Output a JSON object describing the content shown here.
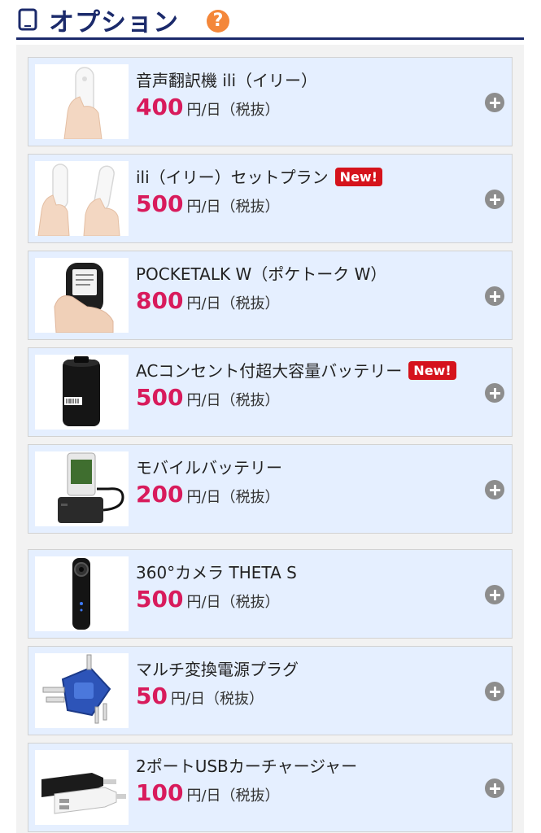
{
  "header": {
    "title": "オプション",
    "help_icon": "?"
  },
  "options": [
    {
      "name": "音声翻訳機 ili（イリー）",
      "badge": "",
      "price": "400",
      "unit": "円/日",
      "tax": "（税抜）",
      "icon": "translator-device"
    },
    {
      "name": "ili（イリー）セットプラン",
      "badge": "New!",
      "price": "500",
      "unit": "円/日",
      "tax": "（税抜）",
      "icon": "translator-set"
    },
    {
      "name": "POCKETALK W（ポケトーク W）",
      "badge": "",
      "price": "800",
      "unit": "円/日",
      "tax": "（税抜）",
      "icon": "pocketalk-device"
    },
    {
      "name": "ACコンセント付超大容量バッテリー",
      "badge": "New!",
      "price": "500",
      "unit": "円/日",
      "tax": "（税抜）",
      "icon": "battery-cylinder"
    },
    {
      "name": "モバイルバッテリー",
      "badge": "",
      "price": "200",
      "unit": "円/日",
      "tax": "（税抜）",
      "icon": "mobile-battery"
    },
    {
      "name": "360°カメラ THETA S",
      "badge": "",
      "price": "500",
      "unit": "円/日",
      "tax": "（税抜）",
      "icon": "camera-360"
    },
    {
      "name": "マルチ変換電源プラグ",
      "badge": "",
      "price": "50",
      "unit": "円/日",
      "tax": "（税抜）",
      "icon": "plug-adapter"
    },
    {
      "name": "2ポートUSBカーチャージャー",
      "badge": "",
      "price": "100",
      "unit": "円/日",
      "tax": "（税抜）",
      "icon": "car-charger"
    }
  ]
}
